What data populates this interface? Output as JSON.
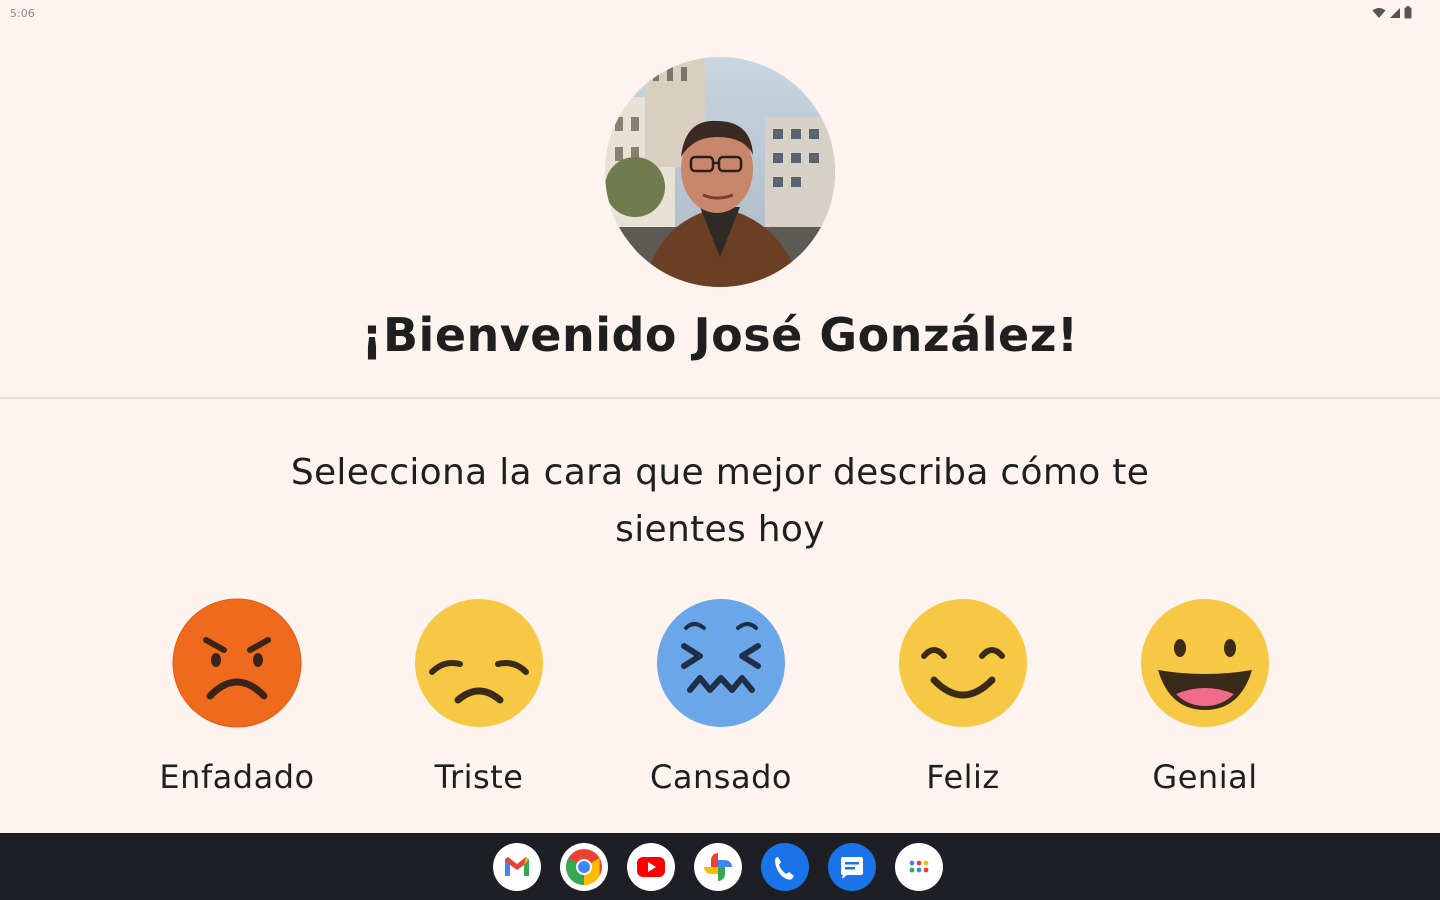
{
  "status_bar": {
    "time": "5:06",
    "icons": [
      "wifi-icon",
      "signal-icon",
      "battery-icon"
    ]
  },
  "user": {
    "avatar": "user-photo"
  },
  "welcome_text": "¡Bienvenido José González!",
  "prompt_text": "Selecciona la cara que mejor describa cómo te sientes hoy",
  "moods": [
    {
      "label": "Enfadado",
      "icon": "angry-face-icon",
      "color": "#f06a1e"
    },
    {
      "label": "Triste",
      "icon": "sad-face-icon",
      "color": "#f7c843"
    },
    {
      "label": "Cansado",
      "icon": "tired-face-icon",
      "color": "#6aa6e8"
    },
    {
      "label": "Feliz",
      "icon": "happy-face-icon",
      "color": "#f7c843"
    },
    {
      "label": "Genial",
      "icon": "grinning-face-icon",
      "color": "#f7c843"
    }
  ],
  "taskbar": {
    "apps": [
      "gmail-icon",
      "chrome-icon",
      "youtube-icon",
      "photos-icon",
      "phone-icon",
      "messages-icon",
      "app-drawer-icon"
    ]
  },
  "colors": {
    "background": "#fdf4f0",
    "taskbar": "#1d1f24",
    "angry": "#f06a1e",
    "yellow": "#f7c843",
    "blue": "#6aa6e8"
  }
}
